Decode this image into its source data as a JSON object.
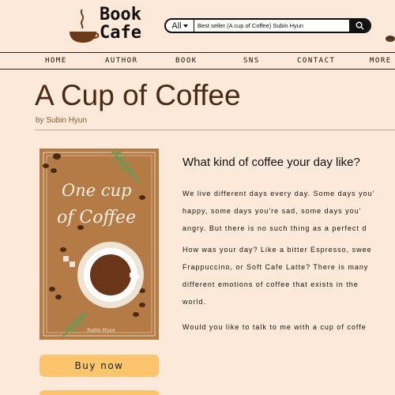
{
  "brand": {
    "line1": "Book",
    "line2": "Cafe"
  },
  "search": {
    "category": "All",
    "value": "Best seller (A cup of Coffee) Subin Hyun",
    "icon": "search-icon"
  },
  "nav": {
    "items": [
      "HOME",
      "AUTHOR",
      "BOOK",
      "SNS",
      "CONTACT",
      "MORE"
    ]
  },
  "book": {
    "title": "A Cup of Coffee",
    "byline": "by Subin Hyun",
    "cover_title_1": "One cup",
    "cover_title_2": "of Coffee",
    "cover_author": "Subin Hyun"
  },
  "description": {
    "heading": "What kind of coffee your day like?",
    "p1": [
      "We live different days every day. Some days you'",
      "happy, some days you're sad, some days you'",
      "angry. But there is no such thing as a perfect d"
    ],
    "p2": [
      "How was your day? Like a bitter Espresso, swee",
      "Frappuccino, or Soft Cafe Latte? There is many",
      "different emotions of coffee that exists in the",
      "world."
    ],
    "p3": [
      "Would you like to talk to me with a cup of coffe"
    ]
  },
  "actions": {
    "buy_now": "Buy now"
  },
  "colors": {
    "background": "#fde9da",
    "title": "#4a2a12",
    "byline": "#8a5a2e",
    "button": "#fcc56b",
    "cover": "#b57b46"
  }
}
